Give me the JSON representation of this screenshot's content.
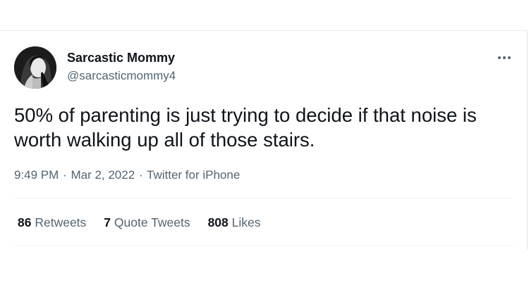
{
  "tweet": {
    "author": {
      "name": "Sarcastic Mommy",
      "handle": "@sarcasticmommy4",
      "avatar_icon": "profile-photo"
    },
    "more_icon": "more-horizontal-icon",
    "text": "50% of parenting is just trying to decide if that noise is worth walking up all of those stairs.",
    "time": "9:49 PM",
    "date": "Mar 2, 2022",
    "source": "Twitter for iPhone",
    "separator": "·",
    "stats": {
      "retweets": {
        "count": "86",
        "label": "Retweets"
      },
      "quote_tweets": {
        "count": "7",
        "label": "Quote Tweets"
      },
      "likes": {
        "count": "808",
        "label": "Likes"
      }
    }
  },
  "colors": {
    "primary_text": "#0f1419",
    "secondary_text": "#536471",
    "divider": "#eff3f4",
    "background": "#ffffff"
  }
}
